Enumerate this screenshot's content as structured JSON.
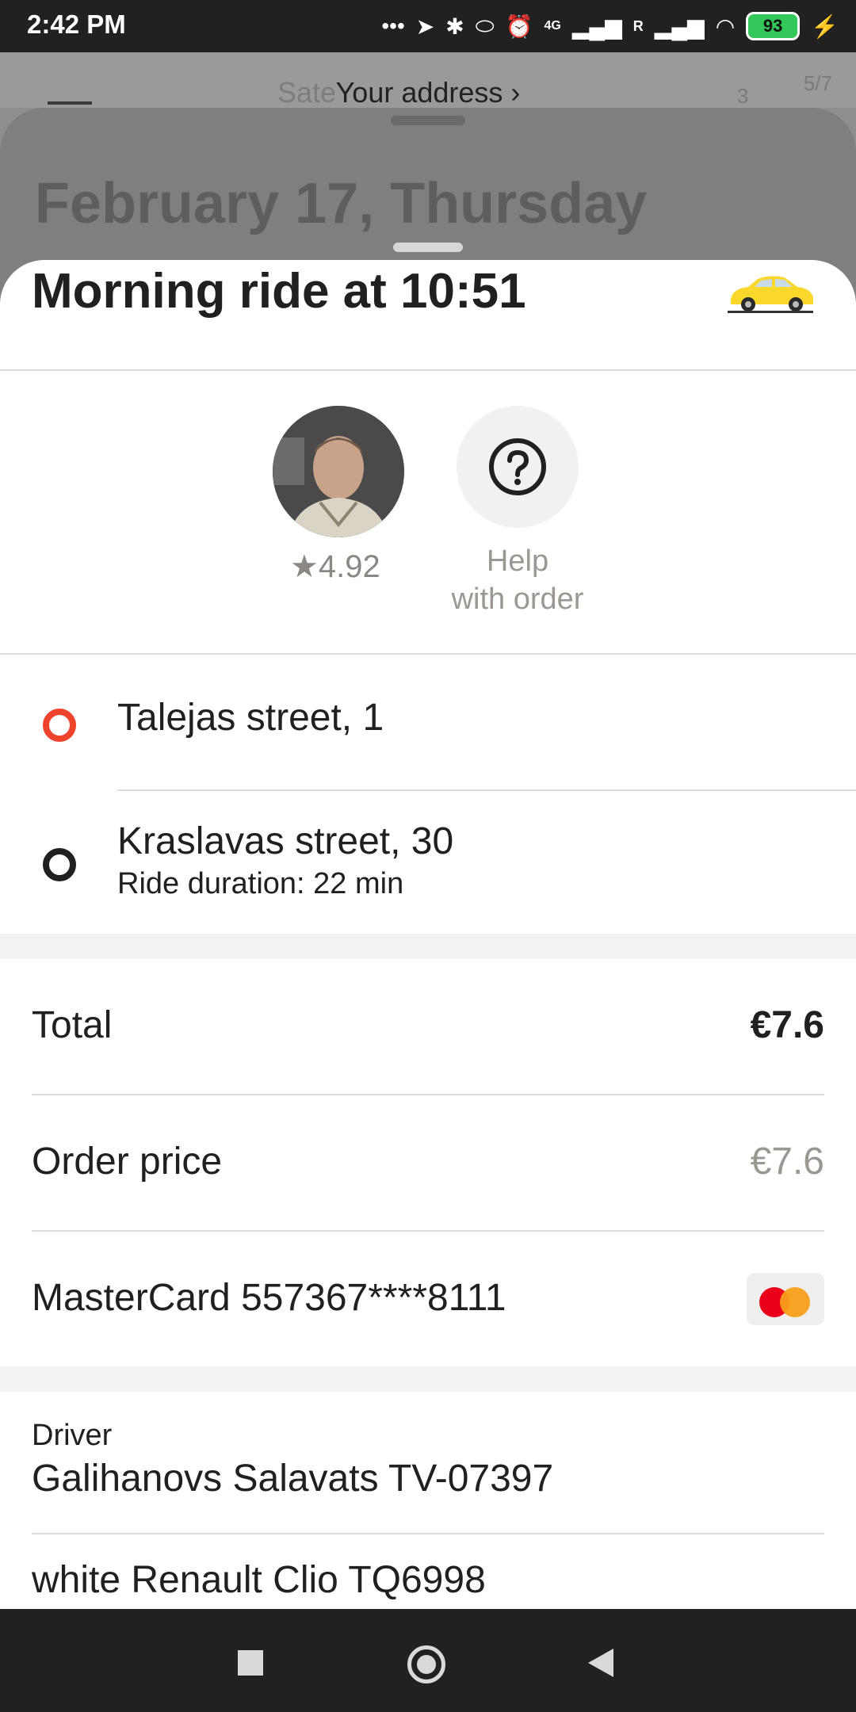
{
  "status_bar": {
    "time": "2:42 PM",
    "battery": "93",
    "network_labels": [
      "4G",
      "R"
    ]
  },
  "background": {
    "map_label": "Sate",
    "map_number_left": "3",
    "map_number_right": "5/7",
    "address_link": "Your address ›",
    "date_title": "February 17, Thursday"
  },
  "ride": {
    "title": "Morning ride at 10:51",
    "driver_rating": "★4.92",
    "help_label_line1": "Help",
    "help_label_line2": "with order"
  },
  "route": {
    "origin": "Talejas street, 1",
    "destination": "Kraslavas street, 30",
    "duration": "Ride duration: 22 min"
  },
  "payment": {
    "total_label": "Total",
    "total_value": "€7.6",
    "order_price_label": "Order price",
    "order_price_value": "€7.6",
    "card_label": "MasterCard 557367****8111"
  },
  "driver": {
    "caption": "Driver",
    "name": "Galihanovs Salavats TV-07397",
    "car": "white Renault Clio TQ6998"
  },
  "colors": {
    "origin_marker": "#f0432e",
    "destination_marker": "#21201f",
    "car_yellow": "#fcd72b"
  }
}
